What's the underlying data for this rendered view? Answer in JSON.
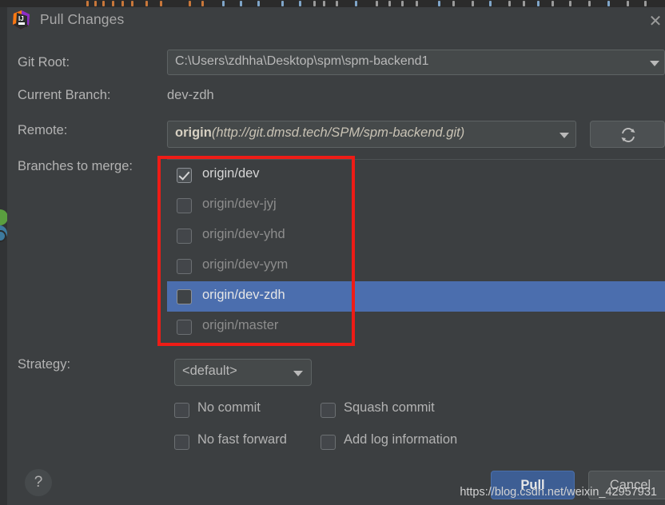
{
  "window": {
    "title": "Pull Changes",
    "logo_icon": "intellij-idea-logo",
    "close_icon": "close-icon"
  },
  "form": {
    "git_root": {
      "label": "Git Root:",
      "value": "C:\\Users\\zdhha\\Desktop\\spm\\spm-backend1",
      "dropdown_icon": "chevron-down-icon"
    },
    "current_branch": {
      "label": "Current Branch:",
      "value": "dev-zdh"
    },
    "remote": {
      "label": "Remote:",
      "value_name": "origin",
      "value_url": "(http://git.dmsd.tech/SPM/spm-backend.git)",
      "dropdown_icon": "chevron-down-icon",
      "refresh_icon": "refresh-icon"
    },
    "branches": {
      "label": "Branches to merge:",
      "items": [
        {
          "name": "origin/dev",
          "checked": true,
          "enabled": true,
          "selected": false
        },
        {
          "name": "origin/dev-jyj",
          "checked": false,
          "enabled": false,
          "selected": false
        },
        {
          "name": "origin/dev-yhd",
          "checked": false,
          "enabled": false,
          "selected": false
        },
        {
          "name": "origin/dev-yym",
          "checked": false,
          "enabled": false,
          "selected": false
        },
        {
          "name": "origin/dev-zdh",
          "checked": false,
          "enabled": false,
          "selected": true
        },
        {
          "name": "origin/master",
          "checked": false,
          "enabled": false,
          "selected": false
        }
      ]
    },
    "strategy": {
      "label": "Strategy:",
      "value": "<default>",
      "dropdown_icon": "chevron-down-icon"
    },
    "options": [
      {
        "label": "No commit",
        "checked": false
      },
      {
        "label": "No fast forward",
        "checked": false
      },
      {
        "label": "Squash commit",
        "checked": false
      },
      {
        "label": "Add log information",
        "checked": false
      }
    ]
  },
  "footer": {
    "help_label": "?",
    "pull_label": "Pull",
    "cancel_label": "Cancel",
    "watermark": "https://blog.csdn.net/weixin_42957931"
  },
  "colors": {
    "dialog_bg": "#3c3f41",
    "selection_blue": "#4b6eae",
    "default_button_blue": "#3d5e94",
    "annotation_red": "#ee1c16",
    "field_bg": "#45494a"
  }
}
